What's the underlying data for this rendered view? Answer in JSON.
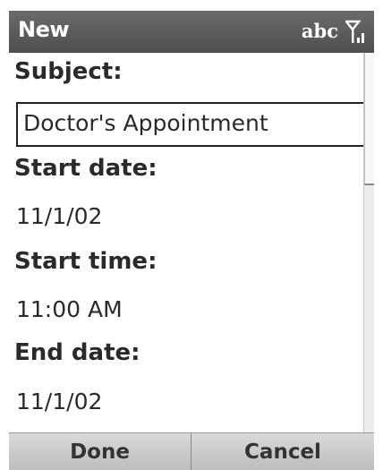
{
  "titlebar": {
    "title": "New",
    "input_mode": "abc",
    "icons": [
      "signal-strength-icon"
    ]
  },
  "form": {
    "subject_label": "Subject:",
    "subject_value": "Doctor's Appointment",
    "start_date_label": "Start date:",
    "start_date_value": "11/1/02",
    "start_time_label": "Start time:",
    "start_time_value": "11:00 AM",
    "end_date_label": "End date:",
    "end_date_value": "11/1/02"
  },
  "softkeys": {
    "left_label": "Done",
    "right_label": "Cancel"
  },
  "colors": {
    "titlebar": "#5a5a5a",
    "softkey_bar": "#cbcbcb",
    "text": "#2a2a2a"
  }
}
